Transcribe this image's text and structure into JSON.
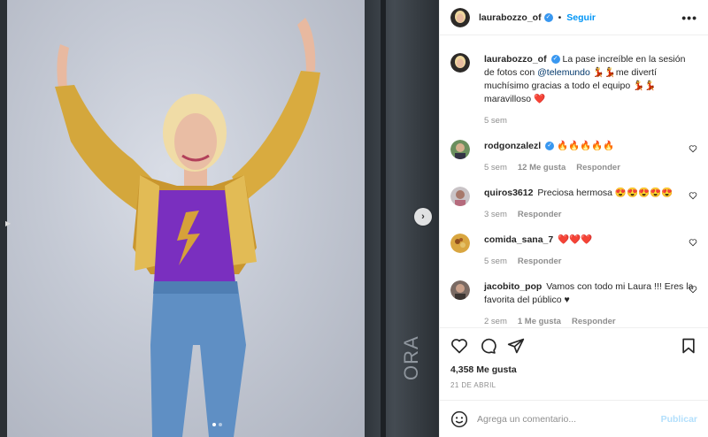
{
  "post": {
    "username": "laurabozzo_of",
    "verified_mark": "✓",
    "follow_separator": "•",
    "follow_label": "Seguir",
    "more_label": "•••"
  },
  "caption": {
    "username": "laurabozzo_of",
    "text_before_mention": " La pase increíble en la sesión de fotos con ",
    "mention": "@telemundo",
    "text_after_mention": " 💃💃me divertí muchísimo gracias a todo el equipo 💃💃 maravilloso ❤️",
    "time": "5 sem"
  },
  "comments": [
    {
      "username": "rodgonzalezl",
      "verified": true,
      "text": "🔥🔥🔥🔥🔥",
      "time": "5 sem",
      "likes": "12 Me gusta",
      "reply": "Responder",
      "avatar_color": "#6b8f5e"
    },
    {
      "username": "quiros3612",
      "verified": false,
      "text": "Preciosa hermosa 😍😍😍😍😍",
      "time": "3 sem",
      "likes": "",
      "reply": "Responder",
      "avatar_color": "#b56a7c"
    },
    {
      "username": "comida_sana_7",
      "verified": false,
      "text": "❤️❤️❤️",
      "time": "5 sem",
      "likes": "",
      "reply": "Responder",
      "avatar_color": "#d9a640"
    },
    {
      "username": "jacobito_pop",
      "verified": false,
      "text": "Vamos con todo mi Laura !!! Eres la favorita del público ♥",
      "time": "2 sem",
      "likes": "1 Me gusta",
      "reply": "Responder",
      "avatar_color": "#7a6a63"
    }
  ],
  "engagement": {
    "likes": "4,358 Me gusta",
    "date": "21 DE ABRIL"
  },
  "composer": {
    "placeholder": "Agrega un comentario...",
    "publish_label": "Publicar"
  },
  "media": {
    "next_glyph": "›",
    "stage_text": "ORA",
    "carousel_total": 2,
    "carousel_active": 1
  },
  "colors": {
    "link_blue": "#0095f6",
    "verified_blue": "#3897f0",
    "mention": "#00376b",
    "muted": "#8e8e8e",
    "publish_disabled": "#b2dffc"
  }
}
